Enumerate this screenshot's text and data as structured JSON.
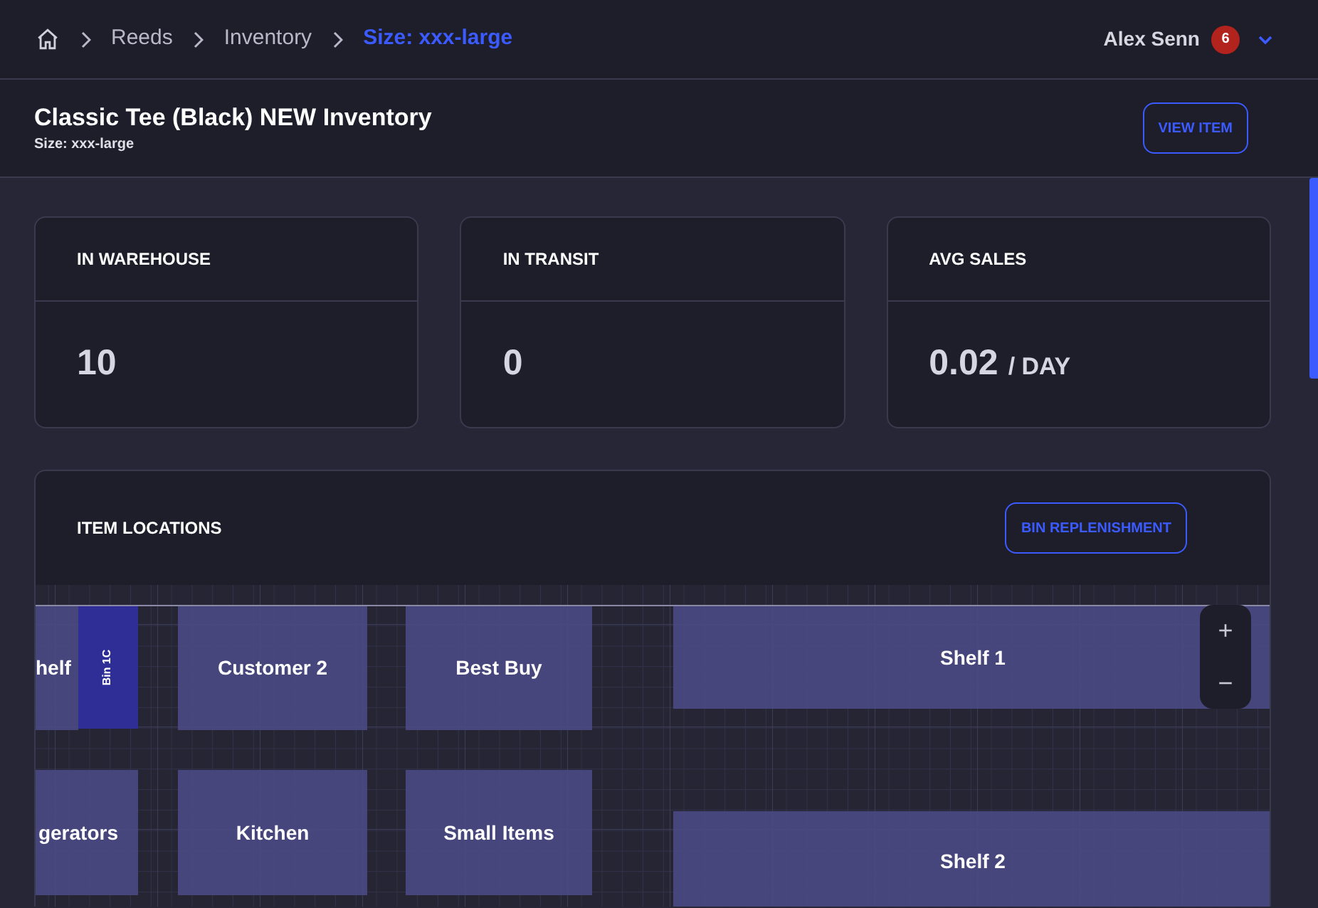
{
  "breadcrumbs": [
    {
      "label": "Reeds",
      "selected": false
    },
    {
      "label": "Inventory",
      "selected": false
    },
    {
      "label": "Size: xxx-large",
      "selected": true
    }
  ],
  "user": {
    "name": "Alex Senn",
    "notifications": "6"
  },
  "page": {
    "title": "Classic Tee (Black) NEW Inventory",
    "subtitle": "Size: xxx-large",
    "button": "VIEW ITEM"
  },
  "stats": [
    {
      "label": "IN WAREHOUSE",
      "value": "10"
    },
    {
      "label": "IN TRANSIT",
      "value": "0"
    },
    {
      "label": "AVG SALES",
      "value": "0.02",
      "unit": "/ DAY"
    }
  ],
  "locations": {
    "title": "ITEM LOCATIONS",
    "button": "BIN REPLENISHMENT",
    "zones": [
      {
        "label": "helf",
        "kind": "zone"
      },
      {
        "label": "Bin 1C",
        "kind": "bin"
      },
      {
        "label": "Customer 2",
        "kind": "zone"
      },
      {
        "label": "Best Buy",
        "kind": "zone"
      },
      {
        "label": "Shelf 1",
        "kind": "zone"
      },
      {
        "label": "gerators",
        "kind": "zone"
      },
      {
        "label": "Kitchen",
        "kind": "zone"
      },
      {
        "label": "Small Items",
        "kind": "zone"
      },
      {
        "label": "Shelf 2",
        "kind": "zone"
      }
    ],
    "zoom": [
      "+",
      "−"
    ]
  }
}
